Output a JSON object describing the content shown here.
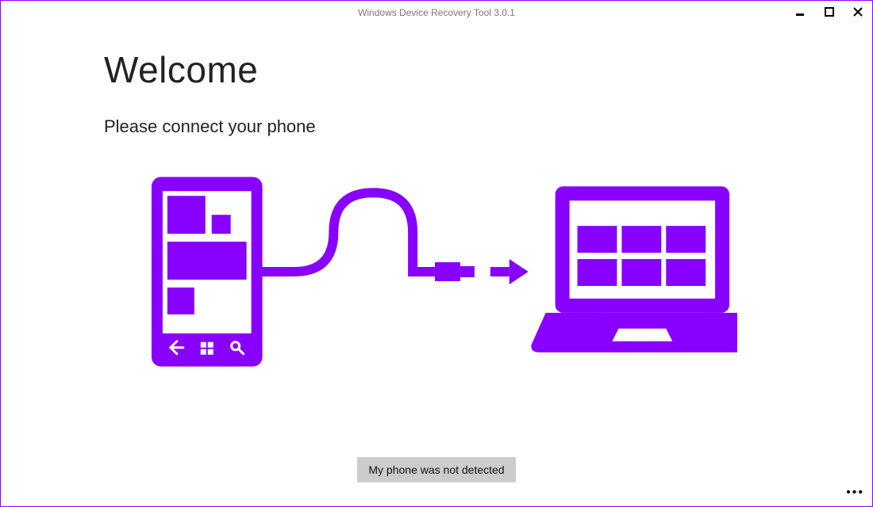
{
  "window": {
    "title": "Windows Device Recovery Tool 3.0.1"
  },
  "main": {
    "heading": "Welcome",
    "subheading": "Please connect your phone"
  },
  "buttons": {
    "not_detected": "My phone was not detected"
  },
  "colors": {
    "accent": "#8800ff"
  }
}
